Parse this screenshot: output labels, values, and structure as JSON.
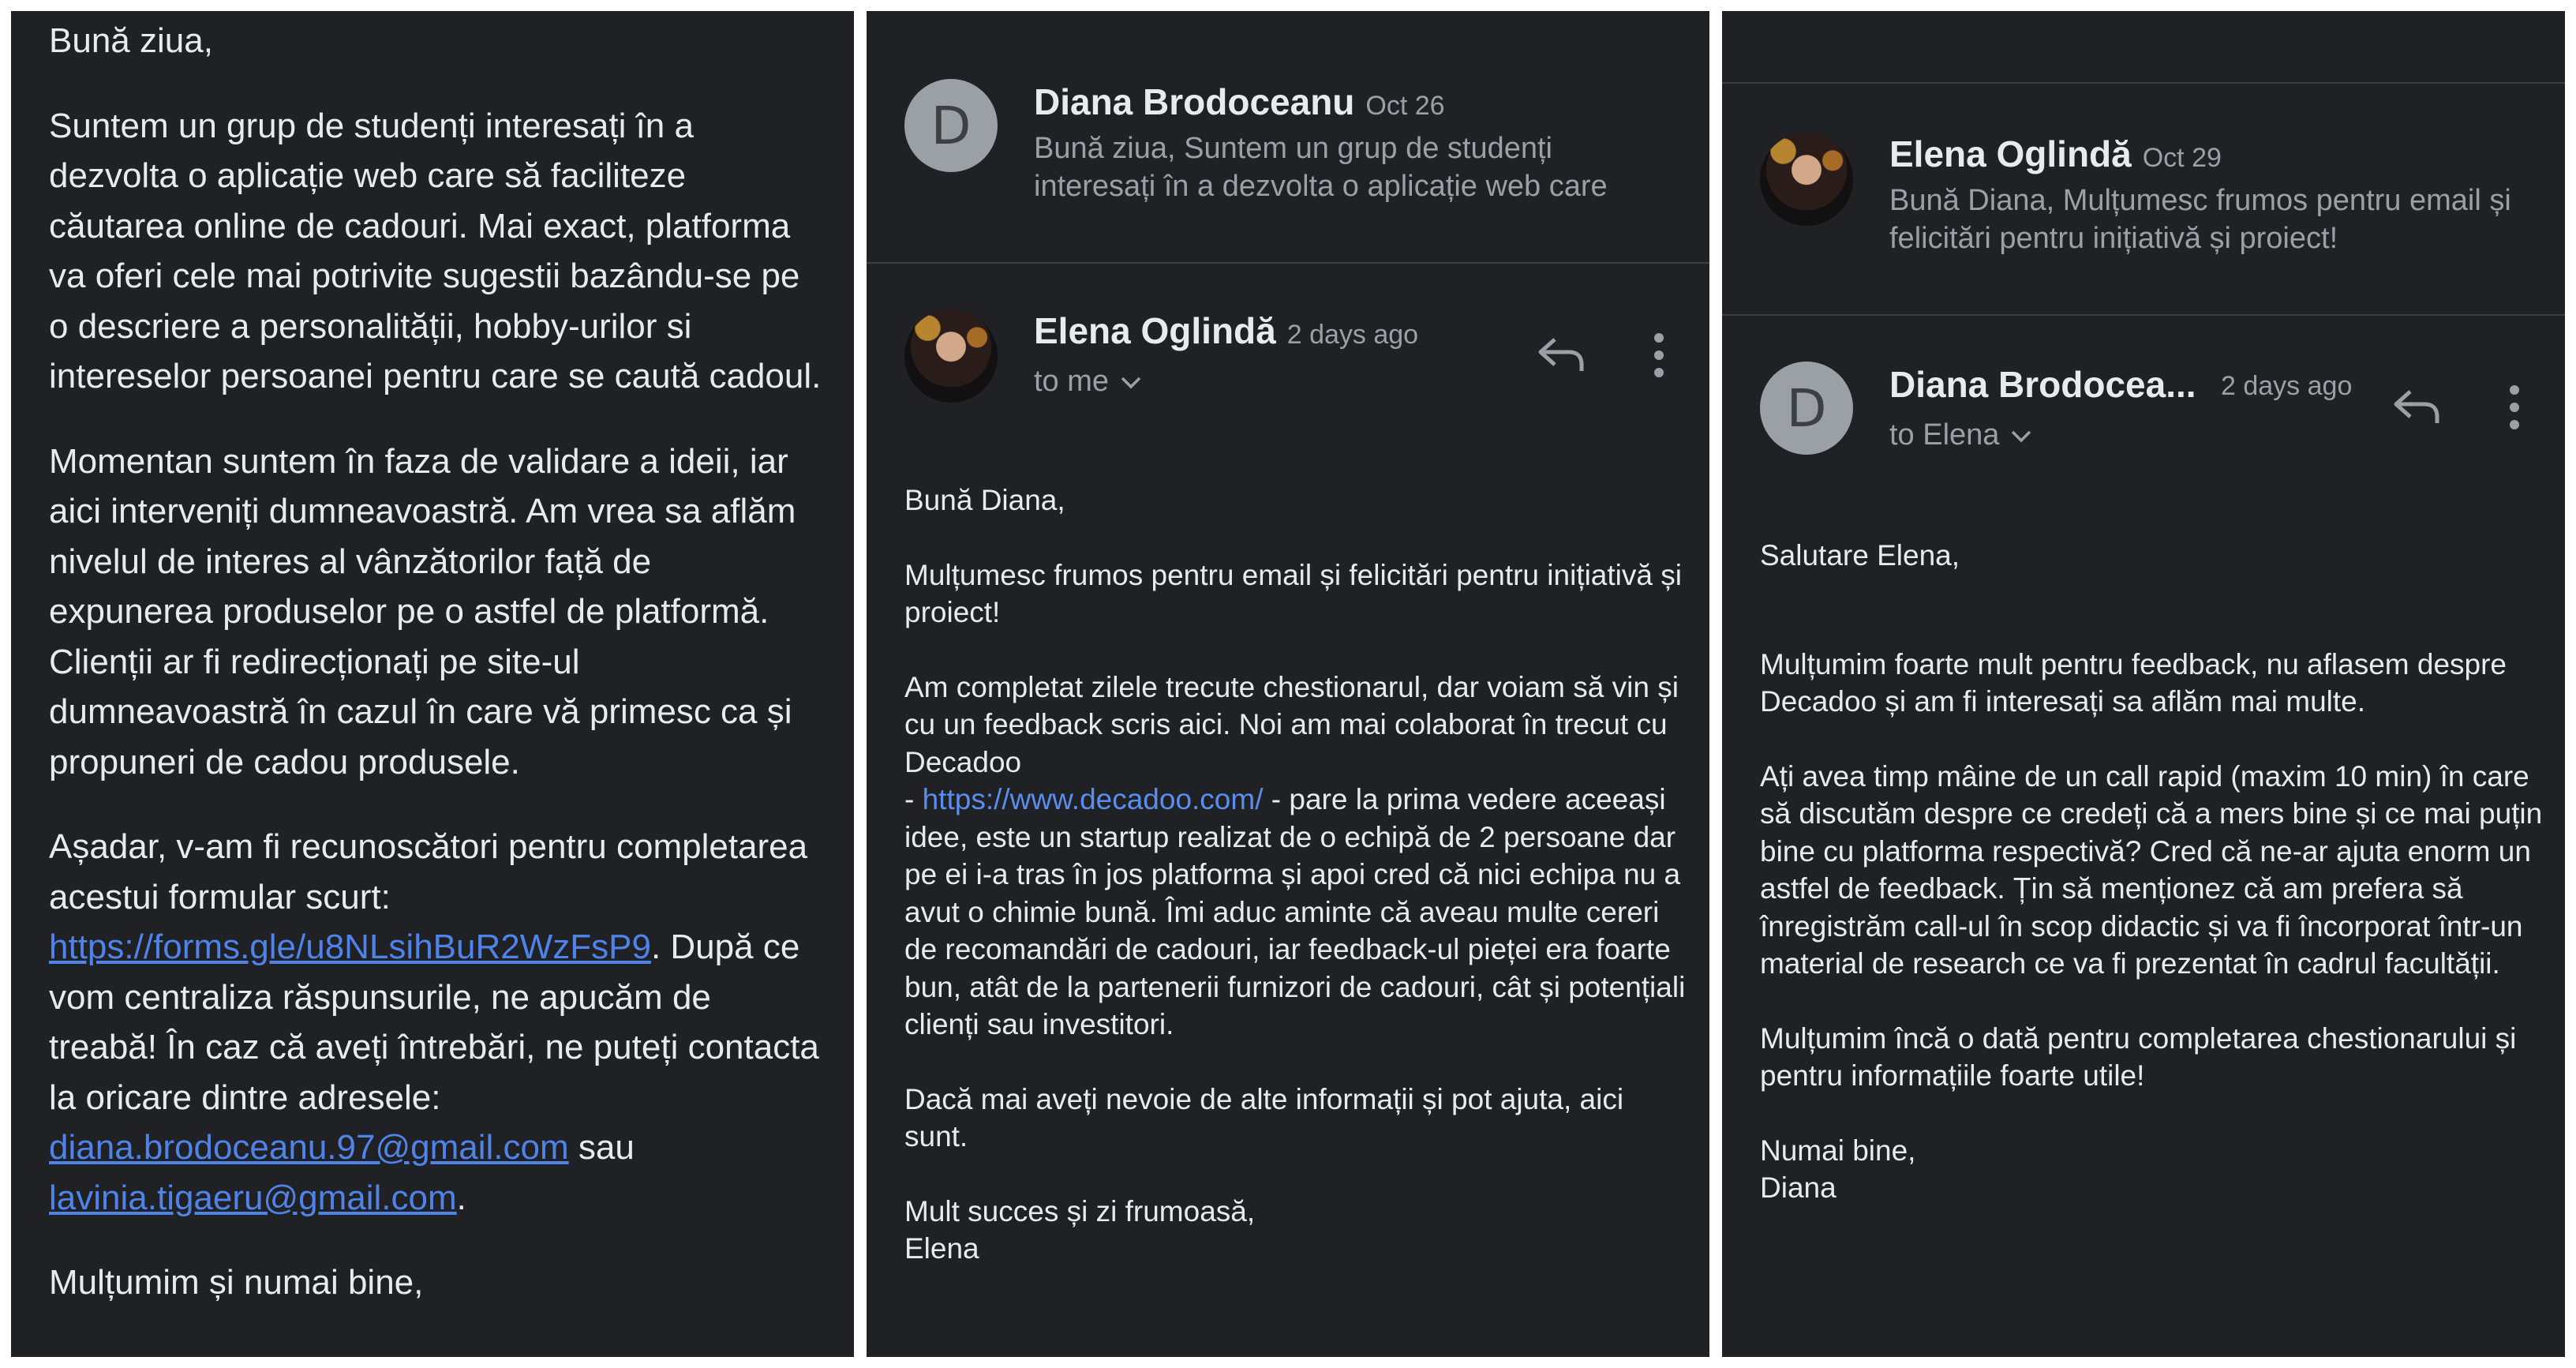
{
  "panel1": {
    "greeting": "Bună ziua,",
    "para1": "Suntem un grup de studenți interesați în a dezvolta o aplicație web care să faciliteze căutarea online de cadouri. Mai exact, platforma va oferi cele mai potrivite sugestii bazându-se pe o descriere a personalității, hobby-urilor si intereselor persoanei pentru care se caută cadoul.",
    "para2": "Momentan suntem în faza de validare a ideii, iar aici interveniți dumneavoastră. Am vrea sa aflăm nivelul de interes al vânzătorilor față de expunerea produselor pe o astfel de platformă. Clienții ar fi redirecționați pe site-ul dumneavoastră în cazul în care vă primesc ca și propuneri de cadou produsele.",
    "para3_a": "Așadar, v-am fi recunoscători pentru completarea acestui formular scurt: ",
    "form_link": "https://forms.gle/u8NLsihBuR2WzFsP9",
    "para3_b": ". După ce vom centraliza răspunsurile, ne apucăm de treabă! În caz că aveți întrebări, ne puteți contacta la oricare dintre adresele: ",
    "email1": "diana.brodoceanu.97@gmail.com",
    "and_word": " sau ",
    "email2": "lavinia.tigaeru@gmail.com",
    "period": ".",
    "closing": "Mulțumim și numai bine,"
  },
  "panel2": {
    "collapsed": {
      "avatar_letter": "D",
      "sender": "Diana Brodoceanu",
      "date": "Oct 26",
      "snippet": "Bună ziua, Suntem un grup de studenți interesați în a dezvolta o aplicație web care"
    },
    "message": {
      "sender": "Elena Oglindă",
      "date": "2 days ago",
      "to": "to me",
      "greeting": "Bună Diana,",
      "p1": "Mulțumesc frumos pentru email și felicitări pentru inițiativă și proiect!",
      "p2_a": "Am completat zilele trecute chestionarul, dar voiam să vin și cu un feedback scris aici. Noi am mai colaborat în trecut cu Decadoo",
      "p2_dash": "- ",
      "p2_link": "https://www.decadoo.com/",
      "p2_b": " - pare la prima vedere aceeași idee, este un startup realizat de o echipă de 2 persoane dar pe ei i-a tras în jos platforma și apoi cred că nici echipa nu a avut o chimie bună. Îmi aduc aminte că aveau multe cereri de recomandări de cadouri, iar feedback-ul pieței era foarte bun, atât de la partenerii furnizori de cadouri, cât și potențiali clienți sau investitori.",
      "p3": "Dacă mai aveți nevoie de alte informații și pot ajuta, aici sunt.",
      "sign1": "Mult succes și zi frumoasă,",
      "sign2": "Elena"
    }
  },
  "panel3": {
    "collapsed": {
      "sender": "Elena Oglindă",
      "date": "Oct 29",
      "snippet": "Bună Diana, Mulțumesc frumos pentru email și felicitări pentru inițiativă și proiect!"
    },
    "message": {
      "avatar_letter": "D",
      "sender": "Diana Brodocea...",
      "date": "2 days ago",
      "to": "to Elena",
      "greeting": "Salutare Elena,",
      "p1": "Mulțumim foarte mult pentru feedback, nu aflasem despre Decadoo și am fi interesați sa aflăm mai multe.",
      "p2": "Ați avea timp mâine de un call rapid (maxim 10 min) în care să discutăm despre ce credeți că a mers bine și ce mai puțin bine cu platforma respectivă? Cred că ne-ar ajuta enorm un astfel de feedback. Țin să menționez că am prefera să înregistrăm call-ul în scop didactic și va fi încorporat într-un material de research ce va fi prezentat în cadrul facultății.",
      "p3": "Mulțumim încă o dată pentru completarea chestionarului și pentru informațiile foarte utile!",
      "sign1": "Numai bine,",
      "sign2": "Diana"
    }
  },
  "colors": {
    "background": "#202124",
    "text": "#e8eaed",
    "muted": "#9aa0a6",
    "link": "#5b8def",
    "divider": "#3c4043"
  }
}
